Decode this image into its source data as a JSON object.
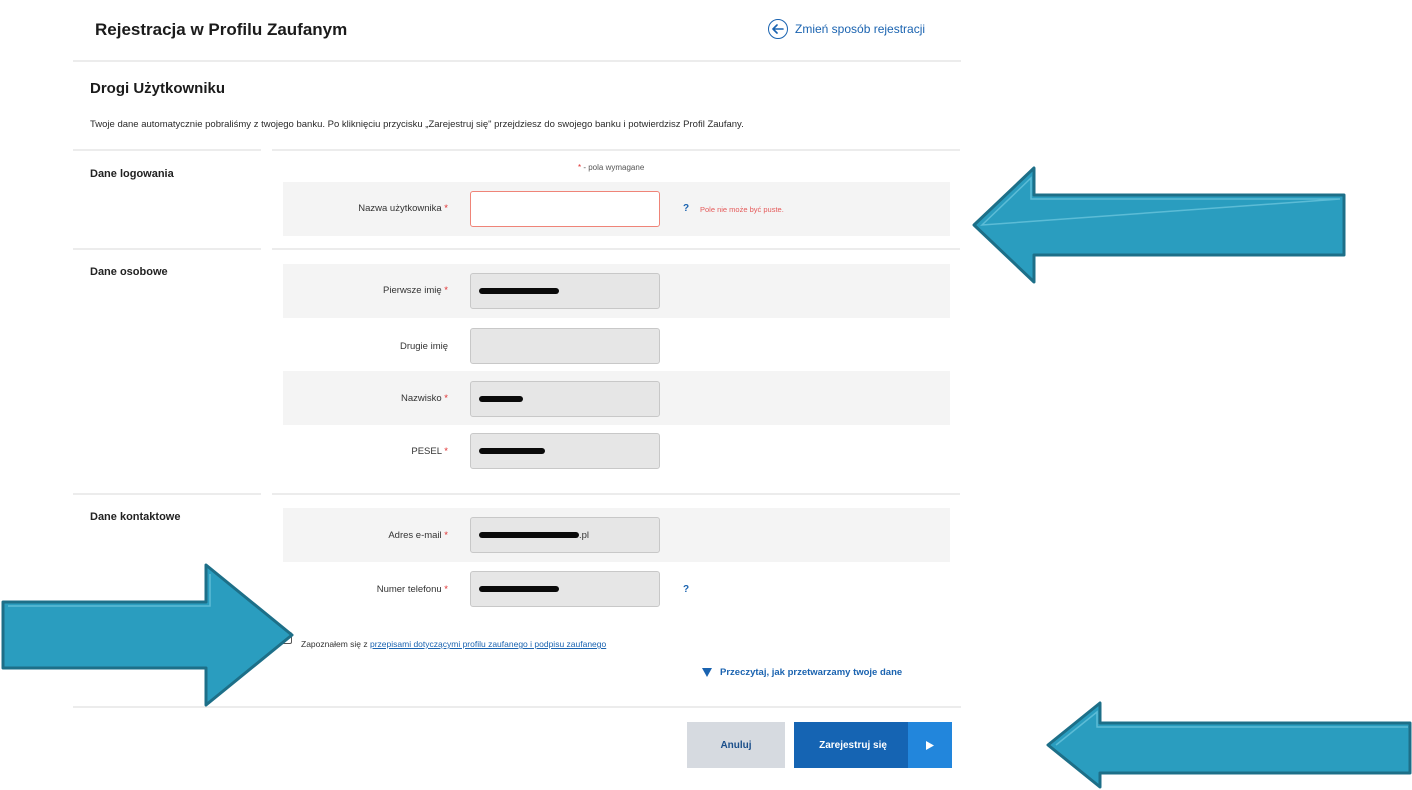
{
  "header": {
    "title": "Rejestracja w Profilu Zaufanym",
    "change_link": "Zmień sposób rejestracji"
  },
  "greeting": "Drogi Użytkowniku",
  "intro": "Twoje dane automatycznie pobraliśmy z twojego banku. Po kliknięciu przycisku „Zarejestruj się\" przejdziesz do swojego banku i potwierdzisz Profil Zaufany.",
  "required_note": {
    "star": "*",
    "text": " - pola wymagane"
  },
  "sections": {
    "login": "Dane logowania",
    "personal": "Dane osobowe",
    "contact": "Dane kontaktowe"
  },
  "fields": {
    "username": {
      "label": "Nazwa użytkownika",
      "value": "",
      "required": true,
      "help": "?",
      "error": "Pole nie może być puste."
    },
    "first_name": {
      "label": "Pierwsze imię",
      "required": true
    },
    "second_name": {
      "label": "Drugie imię",
      "required": false
    },
    "surname": {
      "label": "Nazwisko",
      "required": true
    },
    "pesel": {
      "label": "PESEL",
      "required": true
    },
    "email": {
      "label": "Adres e-mail",
      "required": true,
      "visible_suffix": ".pl"
    },
    "phone": {
      "label": "Numer telefonu",
      "required": true,
      "help": "?"
    }
  },
  "consent": {
    "prefix": "Zapoznałem się z ",
    "link": "przepisami dotyczącymi profilu zaufanego i podpisu zaufanego",
    "checked": false
  },
  "read_more": "Przeczytaj, jak przetwarzamy twoje dane",
  "buttons": {
    "cancel": "Anuluj",
    "register": "Zarejestruj się"
  },
  "star": "*",
  "colors": {
    "brand_blue": "#1564b3",
    "link_blue": "#1a63b0",
    "error_red": "#e55a5a",
    "annotation_arrow": "#2a9dbf"
  },
  "icons": {
    "change_link_icon": "arrow-left-circle-icon",
    "read_more_icon": "triangle-down-icon",
    "register_icon": "play-arrow-icon",
    "annotation": "big-arrow-icon"
  }
}
